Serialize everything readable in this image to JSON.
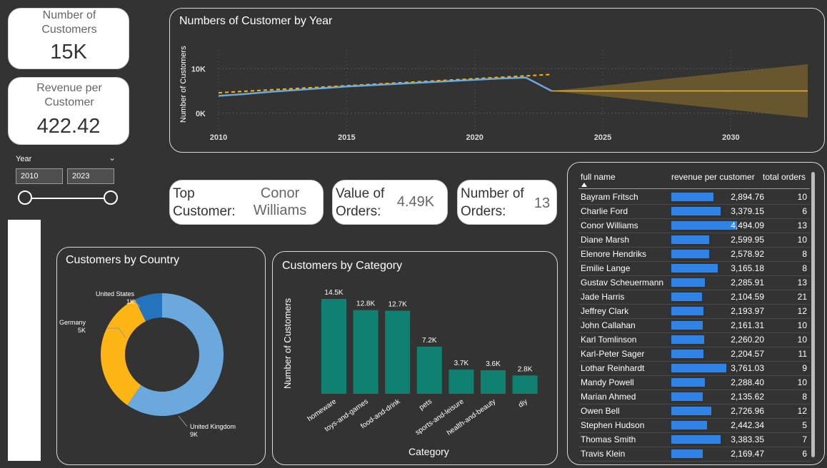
{
  "kpis": {
    "customers_label": "Number of Customers",
    "customers_value": "15K",
    "revenue_label": "Revenue per Customer",
    "revenue_value": "422.42"
  },
  "slicer": {
    "title": "Year",
    "start": "2010",
    "end": "2023",
    "chevron": "chevron-down-icon"
  },
  "top_customer": {
    "label_line1": "Top",
    "label_line2": "Customer:",
    "name_line1": "Conor",
    "name_line2": "Williams"
  },
  "value_orders": {
    "label_line1": "Value of",
    "label_line2": "Orders:",
    "value": "4.49K"
  },
  "number_orders": {
    "label_line1": "Number of",
    "label_line2": "Orders:",
    "value": "13"
  },
  "colors": {
    "background": "#333333",
    "line": "#6fa8dc",
    "trend": "#f5b800",
    "forecast": "#6e5a2f",
    "bar": "#0f8072",
    "tablebar": "#2f83e6",
    "donut_uk": "#6aa8de",
    "donut_de": "#fdb515",
    "donut_us": "#2474bd"
  },
  "chart_data": [
    {
      "type": "line",
      "title": "Numbers of Customer by Year",
      "ylabel": "Number of Customers",
      "x_ticks": [
        "2010",
        "2015",
        "2020",
        "2025",
        "2030"
      ],
      "y_ticks": [
        "0K",
        "10K"
      ],
      "xlim": [
        2010,
        2033
      ],
      "ylim": [
        -4200,
        12600
      ],
      "series": [
        {
          "x": [
            2010,
            2011,
            2012,
            2013,
            2014,
            2015,
            2016,
            2017,
            2018,
            2019,
            2020,
            2021,
            2022,
            2023
          ],
          "values": [
            3900,
            4300,
            4800,
            5200,
            5600,
            6000,
            6300,
            6600,
            6900,
            7200,
            7500,
            7800,
            8000,
            5000
          ]
        }
      ],
      "trend": {
        "x": [
          2010,
          2023
        ],
        "values": [
          4600,
          8700
        ]
      },
      "forecast": {
        "x": [
          2023,
          2033
        ],
        "values": [
          5000,
          5000
        ],
        "lower": [
          5000,
          -1000
        ],
        "upper": [
          5000,
          11000
        ]
      }
    },
    {
      "type": "pie",
      "title": "Customers by Country",
      "slices": [
        {
          "label": "United Kingdom",
          "value_label": "9K",
          "value": 9
        },
        {
          "label": "Germany",
          "value_label": "5K",
          "value": 5
        },
        {
          "label": "United States",
          "value_label": "1K",
          "value": 1.1
        }
      ]
    },
    {
      "type": "bar",
      "title": "Customers by Category",
      "xlabel": "Category",
      "ylabel": "Number of Customers",
      "categories": [
        "homeware",
        "toys-and-games",
        "food-and-drink",
        "pets",
        "sports-and-leisure",
        "health-and-beauty",
        "diy"
      ],
      "values": [
        14.5,
        12.8,
        12.7,
        7.2,
        3.7,
        3.6,
        2.8
      ],
      "value_labels": [
        "14.5K",
        "12.8K",
        "12.7K",
        "7.2K",
        "3.7K",
        "3.6K",
        "2.8K"
      ]
    }
  ],
  "table": {
    "headers": [
      "full name",
      "revenue per customer",
      "total orders"
    ],
    "rows": [
      {
        "name": "Bayram Fritsch",
        "revenue": "2,894.76",
        "rv": 2894.76,
        "orders": "10"
      },
      {
        "name": "Charlie Ford",
        "revenue": "3,379.15",
        "rv": 3379.15,
        "orders": "6"
      },
      {
        "name": "Conor Williams",
        "revenue": "4,494.09",
        "rv": 4494.09,
        "orders": "13"
      },
      {
        "name": "Diane Marsh",
        "revenue": "2,599.95",
        "rv": 2599.95,
        "orders": "10"
      },
      {
        "name": "Elenore Hendriks",
        "revenue": "2,578.92",
        "rv": 2578.92,
        "orders": "8"
      },
      {
        "name": "Emilie Lange",
        "revenue": "3,165.18",
        "rv": 3165.18,
        "orders": "8"
      },
      {
        "name": "Gustav Scheuermann",
        "revenue": "2,285.91",
        "rv": 2285.91,
        "orders": "13"
      },
      {
        "name": "Jade Harris",
        "revenue": "2,104.59",
        "rv": 2104.59,
        "orders": "21"
      },
      {
        "name": "Jeffrey Clark",
        "revenue": "2,193.97",
        "rv": 2193.97,
        "orders": "12"
      },
      {
        "name": "John Callahan",
        "revenue": "2,161.31",
        "rv": 2161.31,
        "orders": "10"
      },
      {
        "name": "Karl Tomlinson",
        "revenue": "2,260.20",
        "rv": 2260.2,
        "orders": "10"
      },
      {
        "name": "Karl-Peter Sager",
        "revenue": "2,204.57",
        "rv": 2204.57,
        "orders": "11"
      },
      {
        "name": "Lothar Reinhardt",
        "revenue": "3,761.03",
        "rv": 3761.03,
        "orders": "9"
      },
      {
        "name": "Mandy Powell",
        "revenue": "2,288.40",
        "rv": 2288.4,
        "orders": "10"
      },
      {
        "name": "Marian Ahmed",
        "revenue": "2,135.62",
        "rv": 2135.62,
        "orders": "8"
      },
      {
        "name": "Owen Bell",
        "revenue": "2,726.96",
        "rv": 2726.96,
        "orders": "12"
      },
      {
        "name": "Stephen Hudson",
        "revenue": "2,442.34",
        "rv": 2442.34,
        "orders": "5"
      },
      {
        "name": "Thomas Smith",
        "revenue": "3,383.35",
        "rv": 3383.35,
        "orders": "7"
      },
      {
        "name": "Travis Klein",
        "revenue": "2,169.47",
        "rv": 2169.47,
        "orders": "6"
      }
    ]
  }
}
